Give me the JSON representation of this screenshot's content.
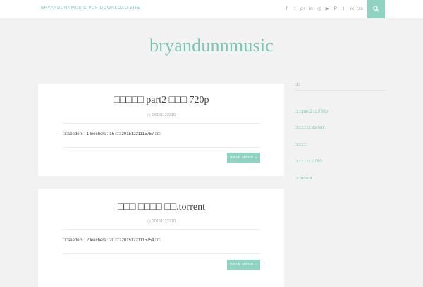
{
  "topbar": {
    "site_link": "BRYANDUNNMUSIC PDF DOWNLOAD SITE",
    "social_icons": [
      "f",
      "t",
      "g+",
      "in",
      "◎",
      "▶",
      "P",
      "t",
      "vk",
      "rss"
    ]
  },
  "site": {
    "title": "bryandunnmusic"
  },
  "posts": [
    {
      "title": "□□□□□ part2 □□□ 720p",
      "date": "20151122210",
      "excerpt": "□□seeders : 1 leechers : 16 □□ 20151221115757 □□",
      "read_more": "READ MORE »"
    },
    {
      "title": "□□□ □□□□ □□.torrent",
      "date": "20151122210",
      "excerpt": "□□seeders : 2 leechers : 20 □□ 20151221115754 □□.",
      "read_more": "READ MORE »"
    }
  ],
  "sidebar": {
    "widget_title": "□□",
    "items": [
      "□□□part2 □□720p",
      "□□□□□□□torrent",
      "□□□□□",
      "□□□□□□□1080",
      "□□torrent"
    ]
  },
  "colors": {
    "accent": "#8fd3c3",
    "title": "#7ac8b4",
    "background": "#f2f2f2"
  }
}
